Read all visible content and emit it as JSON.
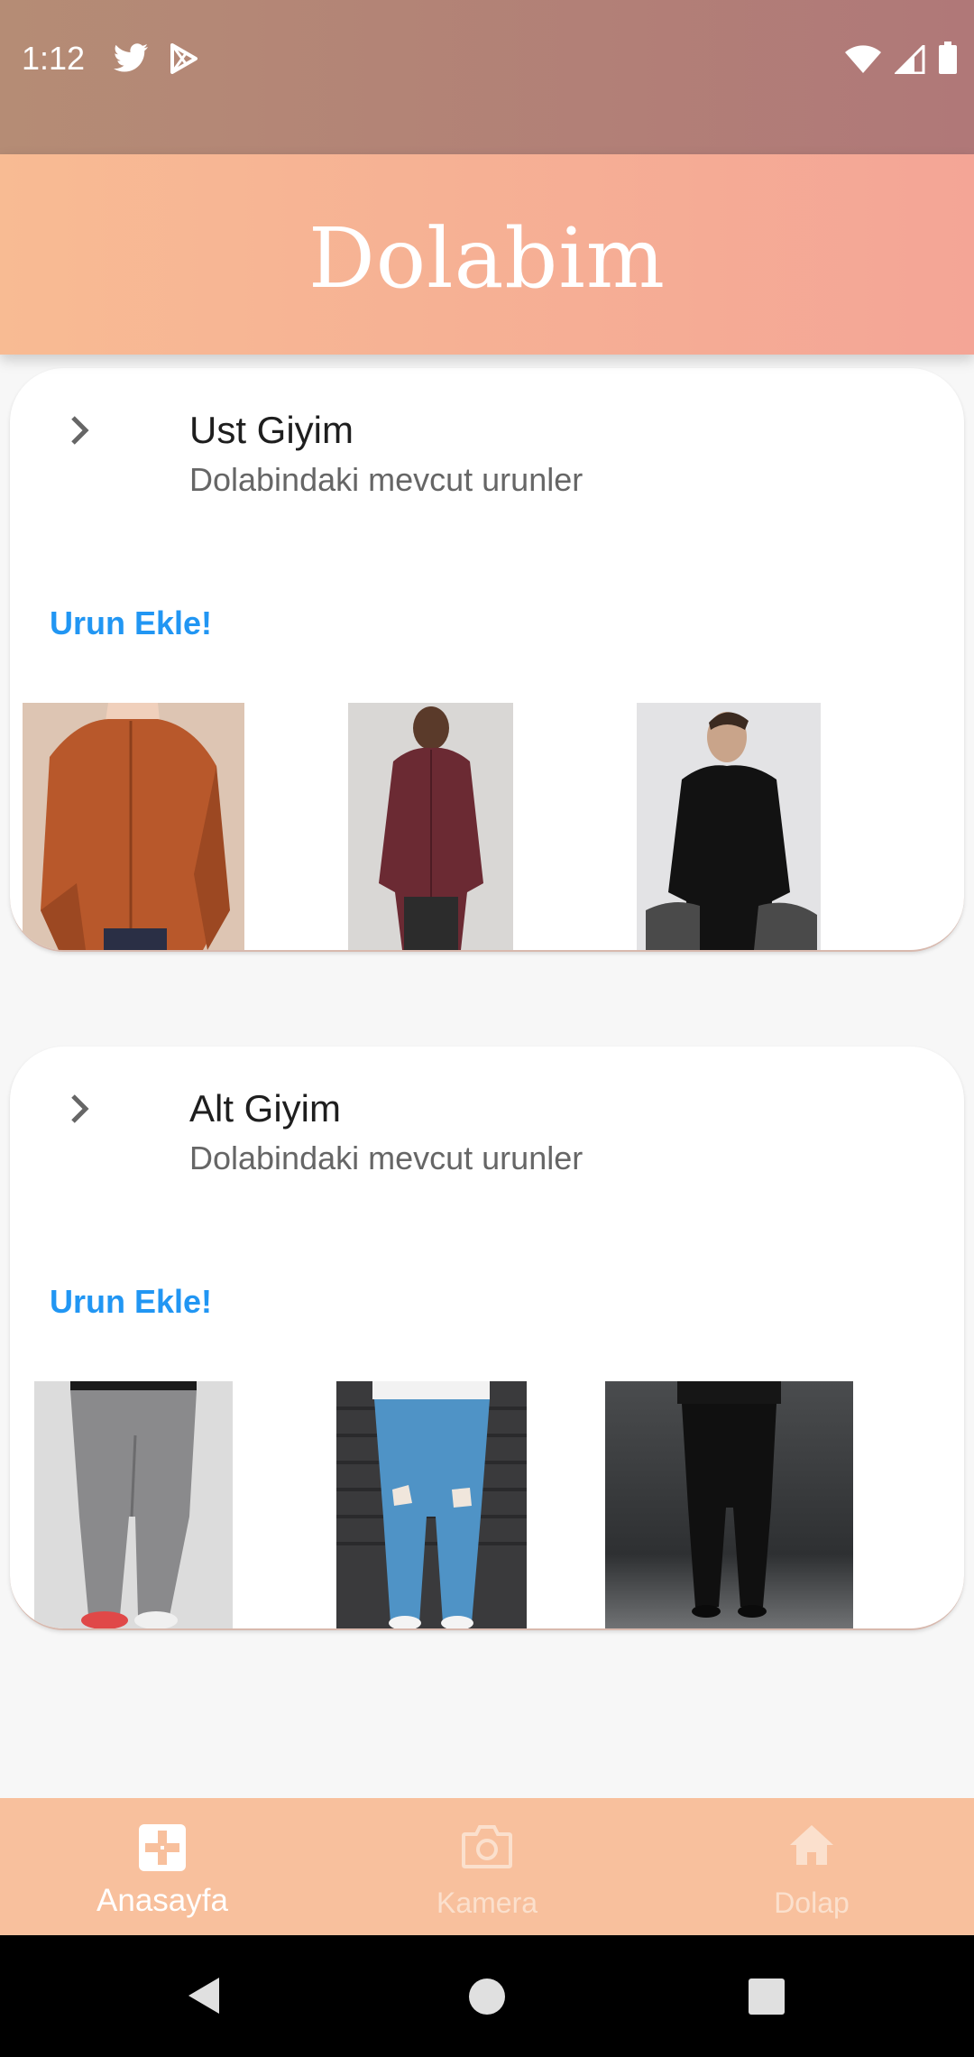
{
  "status_bar": {
    "time": "1:12",
    "left_icons": [
      "twitter-icon",
      "play-store-icon"
    ],
    "right_icons": [
      "wifi-icon",
      "signal-icon",
      "battery-icon"
    ]
  },
  "app_bar": {
    "title": "Dolabim"
  },
  "sections": [
    {
      "title": "Ust Giyim",
      "subtitle": "Dolabindaki mevcut urunler",
      "add_label": "Urun Ekle!",
      "items": [
        "orange-shirt",
        "burgundy-shirt",
        "black-shirt"
      ]
    },
    {
      "title": "Alt Giyim",
      "subtitle": "Dolabindaki mevcut urunler",
      "add_label": "Urun Ekle!",
      "items": [
        "grey-jeans",
        "blue-ripped-jeans",
        "black-trousers"
      ]
    }
  ],
  "bottom_nav": {
    "items": [
      {
        "label": "Anasayfa",
        "icon": "home-grid-icon",
        "active": true
      },
      {
        "label": "Kamera",
        "icon": "camera-icon",
        "active": false
      },
      {
        "label": "Dolap",
        "icon": "house-icon",
        "active": false
      }
    ]
  },
  "colors": {
    "status_bar": "#b58c75",
    "app_bar_start": "#f8bb93",
    "app_bar_end": "#f4a596",
    "accent_link": "#2196f3",
    "bottom_nav": "#f8c09d"
  }
}
